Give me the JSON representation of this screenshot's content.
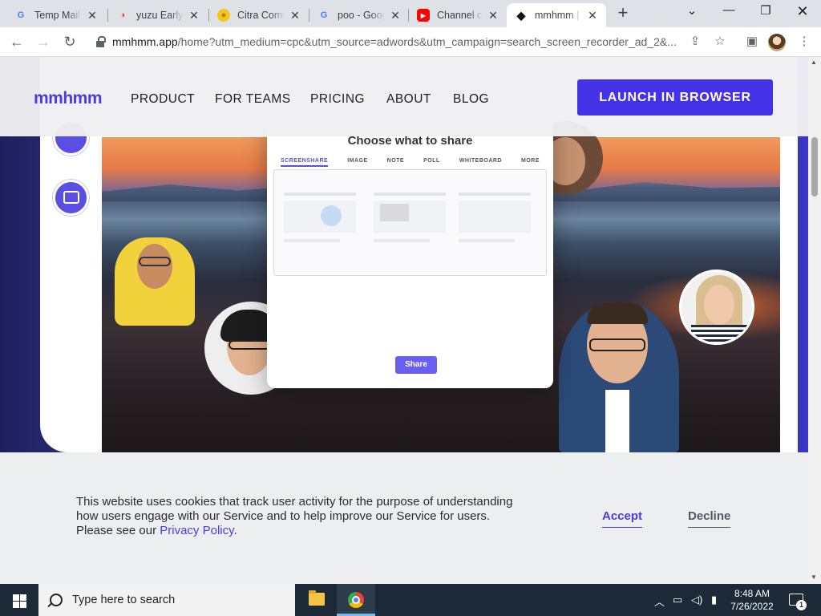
{
  "browser": {
    "tabs": [
      {
        "title": "Temp Mail",
        "favicon": "google-icon",
        "active": false
      },
      {
        "title": "yuzu Early Access",
        "favicon": "yuzu-icon",
        "active": false
      },
      {
        "title": "Citra Community",
        "favicon": "citra-icon",
        "active": false
      },
      {
        "title": "poo - Google Search",
        "favicon": "google-icon",
        "active": false
      },
      {
        "title": "Channel content",
        "favicon": "youtube-icon",
        "active": false
      },
      {
        "title": "mmhmm | Make",
        "favicon": "mmhmm-icon",
        "active": true
      }
    ],
    "url_host": "mmhmm.app",
    "url_path": "/home?utm_medium=cpc&utm_source=adwords&utm_campaign=search_screen_recorder_ad_2&..."
  },
  "site": {
    "logo": "mmhmm",
    "nav": [
      "PRODUCT",
      "FOR TEAMS",
      "PRICING",
      "ABOUT",
      "BLOG"
    ],
    "launch_button": "LAUNCH IN BROWSER"
  },
  "share_dialog": {
    "title": "Choose what to share",
    "tabs": [
      "SCREENSHARE",
      "IMAGE",
      "NOTE",
      "POLL",
      "WHITEBOARD",
      "MORE"
    ],
    "active_tab": "SCREENSHARE",
    "share_button": "Share"
  },
  "cookie_banner": {
    "text": "This website uses cookies that track user activity for the purpose of understanding how users engage with our Service and to help improve our Service for users. Please see our",
    "link_text": "Privacy Policy",
    "period": ".",
    "accept": "Accept",
    "decline": "Decline"
  },
  "taskbar": {
    "search_placeholder": "Type here to search",
    "time": "8:48 AM",
    "date": "7/26/2022",
    "notification_count": "1"
  },
  "colors": {
    "brand": "#4433e6",
    "accent": "#4a3ce0"
  }
}
